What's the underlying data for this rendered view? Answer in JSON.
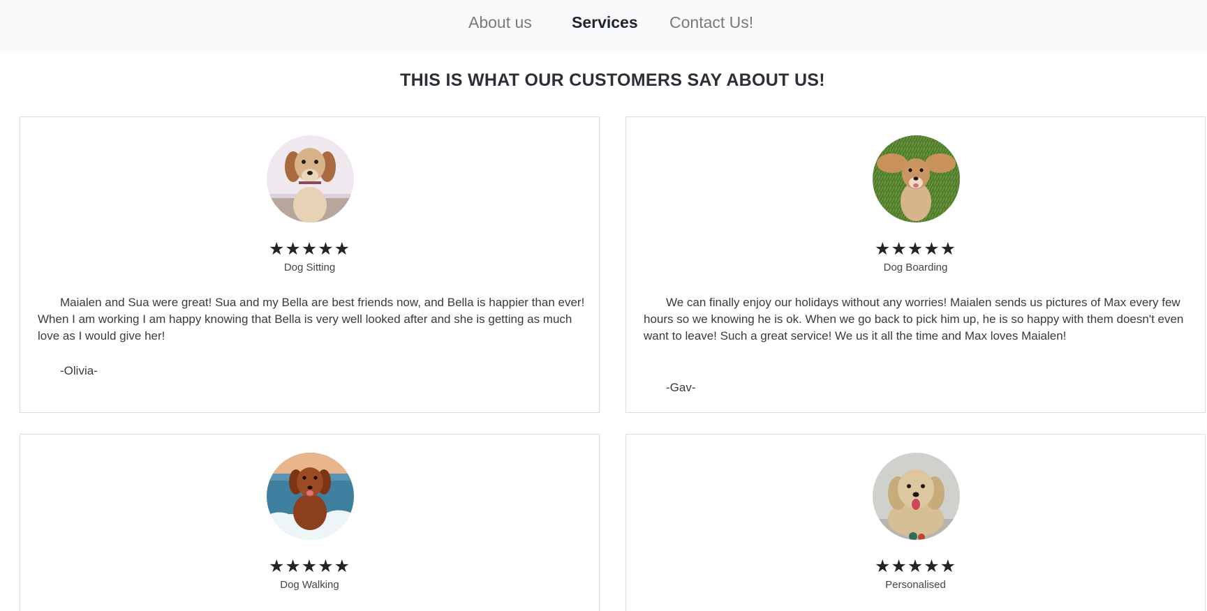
{
  "nav": {
    "items": [
      {
        "label": "About us",
        "active": false
      },
      {
        "label": "Services",
        "active": true
      },
      {
        "label": "Contact Us!",
        "active": false
      }
    ]
  },
  "heading": "THIS IS WHAT OUR CUSTOMERS SAY ABOUT US!",
  "stars_glyph": "★★★★★",
  "testimonials": [
    {
      "rating": 5,
      "service": "Dog Sitting",
      "text": "Maialen and Sua were great! Sua and my Bella are best friends now, and Bella is happier than ever! When I am working I am happy knowing that Bella is very well looked after and she is getting as much love as I would give her!",
      "author": "-Olivia-",
      "photo": "dog-photo-spaniel-beach"
    },
    {
      "rating": 5,
      "service": "Dog Boarding",
      "text": "We can finally enjoy our holidays without any worries! Maialen sends us pictures of Max every few hours so we knowing he is ok. When we go back to pick him up, he is so happy with them doesn't even want to leave! Such a great service! We us it all the time and Max loves Maialen!",
      "author": "-Gav-",
      "photo": "dog-photo-grass"
    },
    {
      "rating": 5,
      "service": "Dog Walking",
      "text": "",
      "author": "",
      "photo": "dog-photo-retriever-sea"
    },
    {
      "rating": 5,
      "service": "Personalised",
      "text": "",
      "author": "",
      "photo": "dog-photo-doodle"
    }
  ],
  "colors": {
    "navbar_bg": "#f8f9fa",
    "text_dark": "#212529",
    "nav_inactive": "#7a7a7a",
    "card_border": "#dcdcdc"
  }
}
